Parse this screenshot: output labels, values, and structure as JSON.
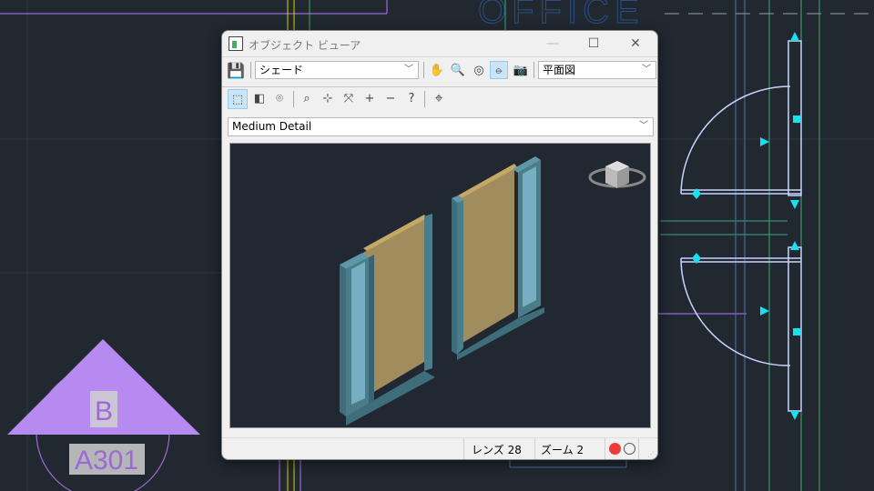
{
  "background": {
    "office_label": "OFFICE",
    "tag_letter": "B",
    "tag_sheet": "A301"
  },
  "dialog": {
    "title": "オブジェクト ビューア",
    "window_buttons": {
      "minimize": "—",
      "maximize": "☐",
      "close": "✕"
    },
    "toolbar1": {
      "visual_style": "シェード",
      "view": "平面図"
    },
    "toolbar2": {
      "detail_level": "Medium Detail"
    },
    "status": {
      "lens": "レンズ 28",
      "zoom": "ズーム 2"
    },
    "colors": {
      "record": "#f03a3a",
      "accent": "#cce4f7"
    }
  }
}
